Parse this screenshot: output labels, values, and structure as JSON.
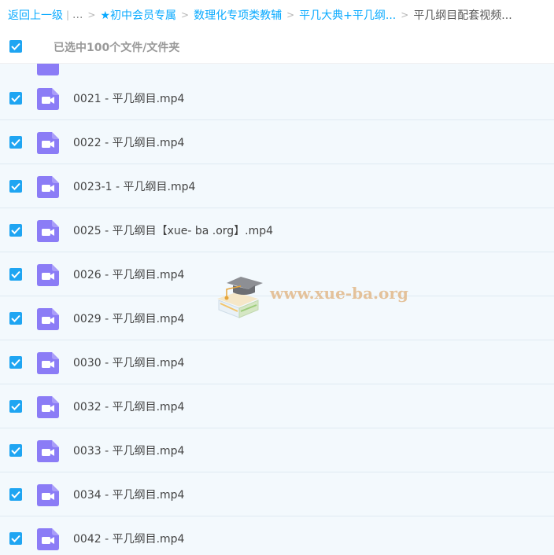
{
  "breadcrumb": {
    "back_label": "返回上一级",
    "divider": "|",
    "ellipsis": "...",
    "sep": ">",
    "items": [
      {
        "label": "★初中会员专属"
      },
      {
        "label": "数理化专项类教辅"
      },
      {
        "label": "平几大典+平几纲..."
      }
    ],
    "current": "平几纲目配套视频..."
  },
  "selection": {
    "label": "已选中100个文件/文件夹",
    "checked": true
  },
  "files": [
    {
      "name": "0021 - 平几纲目.mp4",
      "checked": true
    },
    {
      "name": "0022 - 平几纲目.mp4",
      "checked": true
    },
    {
      "name": "0023-1 - 平几纲目.mp4",
      "checked": true
    },
    {
      "name": "0025 - 平几纲目【xue- ba .org】.mp4",
      "checked": true
    },
    {
      "name": "0026 - 平几纲目.mp4",
      "checked": true
    },
    {
      "name": "0029 - 平几纲目.mp4",
      "checked": true
    },
    {
      "name": "0030 - 平几纲目.mp4",
      "checked": true
    },
    {
      "name": "0032 - 平几纲目.mp4",
      "checked": true
    },
    {
      "name": "0033 - 平几纲目.mp4",
      "checked": true
    },
    {
      "name": "0034 - 平几纲目.mp4",
      "checked": true
    },
    {
      "name": "0042 - 平几纲目.mp4",
      "checked": true
    }
  ],
  "file_icon": "video-file-icon",
  "colors": {
    "link": "#09aaff",
    "checkbox": "#1fa5f2",
    "file_icon": "#8b7cf6",
    "row_bg": "#f3f9fd"
  },
  "watermark": {
    "text": "www.xue-ba.org"
  }
}
